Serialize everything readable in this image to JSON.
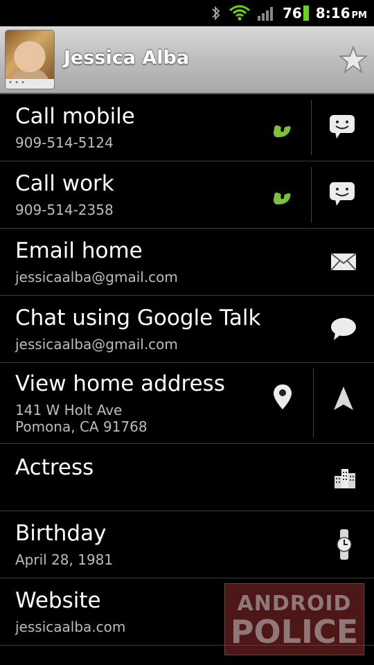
{
  "status_bar": {
    "battery": "76",
    "time": "8:16",
    "ampm": "PM"
  },
  "header": {
    "name": "Jessica Alba"
  },
  "rows": [
    {
      "primary": "Call mobile",
      "secondary": "909-514-5124"
    },
    {
      "primary": "Call work",
      "secondary": "909-514-2358"
    },
    {
      "primary": "Email home",
      "secondary": "jessicaalba@gmail.com"
    },
    {
      "primary": "Chat using Google Talk",
      "secondary": "jessicaalba@gmail.com"
    },
    {
      "primary": "View home address",
      "secondary": "141 W Holt Ave",
      "secondary2": "Pomona, CA 91768"
    },
    {
      "primary": "Actress"
    },
    {
      "primary": "Birthday",
      "secondary": "April 28, 1981"
    },
    {
      "primary": "Website",
      "secondary": "jessicaalba.com"
    }
  ],
  "watermark": {
    "line1": "ANDROID",
    "line2": "POLICE"
  },
  "icons": {
    "call": "phone-icon",
    "sms": "sms-icon",
    "email": "envelope-icon",
    "chat": "chat-bubble-icon",
    "map": "map-pin-icon",
    "navigate": "navigation-arrow-icon",
    "org": "buildings-icon",
    "event": "watch-icon",
    "favorite": "star-icon"
  },
  "colors": {
    "call_green": "#7bc13a",
    "header_bg": "#bdbdbd",
    "secondary_text": "#bdbdbd"
  }
}
